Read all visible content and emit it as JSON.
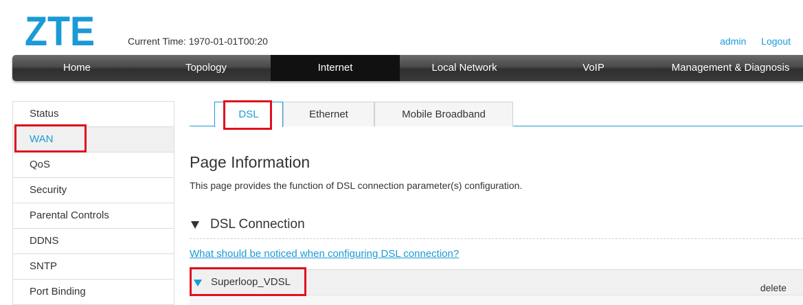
{
  "header": {
    "logo_text": "ZTE",
    "current_time_label": "Current Time: 1970-01-01T00:20",
    "user": "admin",
    "logout": "Logout"
  },
  "topnav": [
    {
      "label": "Home",
      "active": false
    },
    {
      "label": "Topology",
      "active": false
    },
    {
      "label": "Internet",
      "active": true
    },
    {
      "label": "Local Network",
      "active": false
    },
    {
      "label": "VoIP",
      "active": false
    },
    {
      "label": "Management & Diagnosis",
      "active": false
    }
  ],
  "sidebar": {
    "items": [
      {
        "label": "Status"
      },
      {
        "label": "WAN",
        "active": true
      },
      {
        "label": "QoS"
      },
      {
        "label": "Security"
      },
      {
        "label": "Parental Controls"
      },
      {
        "label": "DDNS"
      },
      {
        "label": "SNTP"
      },
      {
        "label": "Port Binding"
      }
    ]
  },
  "tabs": [
    {
      "label": "DSL",
      "active": true
    },
    {
      "label": "Ethernet"
    },
    {
      "label": "Mobile Broadband"
    }
  ],
  "main": {
    "title": "Page Information",
    "description": "This page provides the function of DSL connection parameter(s) configuration.",
    "section_title": "DSL Connection",
    "notice_link": "What should be noticed when configuring DSL connection?",
    "connection": {
      "name": "Superloop_VDSL",
      "delete_label": "delete"
    }
  },
  "colors": {
    "accent": "#1a9ad6",
    "highlight": "#e0101e",
    "nav_bg": "#3a3a3a",
    "nav_active": "#111111"
  }
}
